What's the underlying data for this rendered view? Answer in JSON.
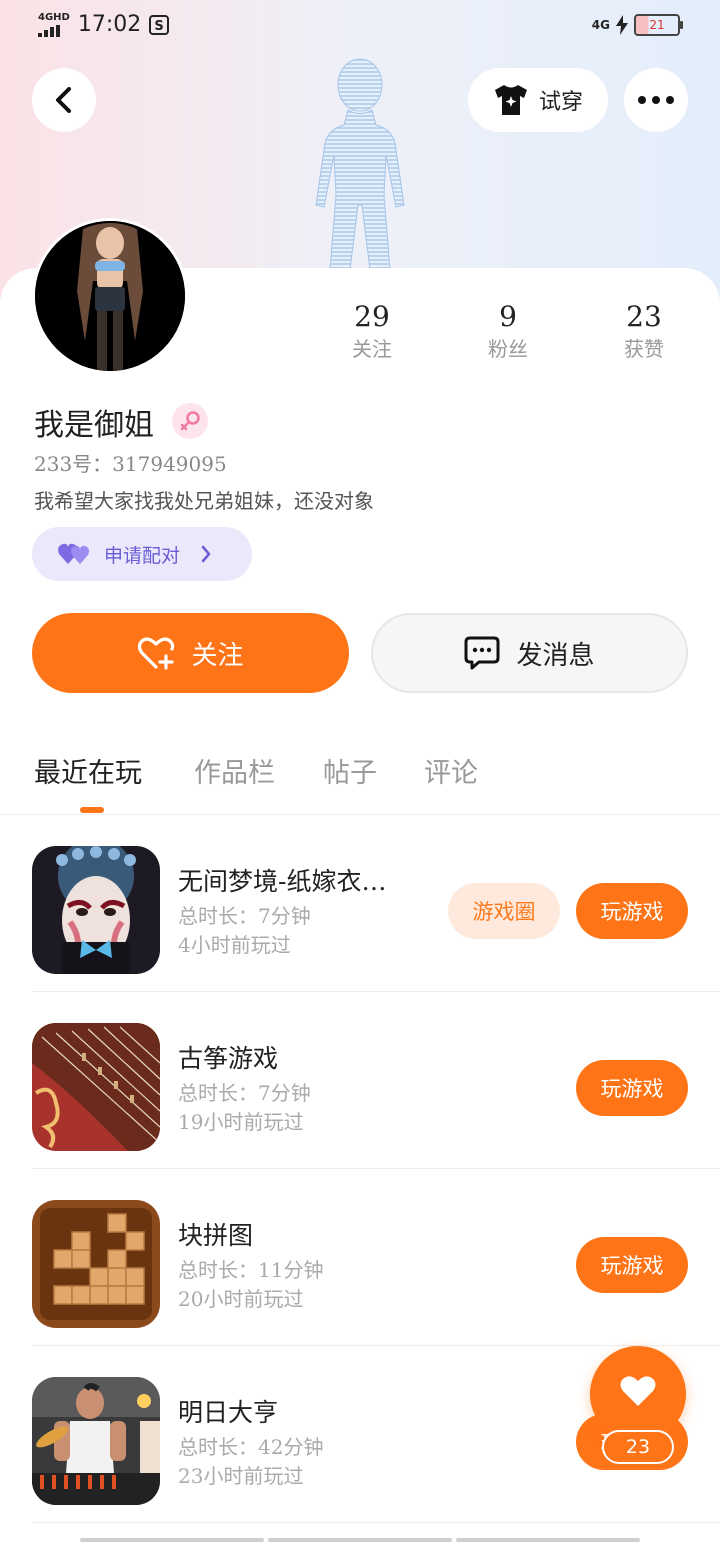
{
  "status_bar": {
    "network_left": "4GHD",
    "time": "17:02",
    "network_right": "4G",
    "battery": "21"
  },
  "header": {
    "try_on_label": "试穿"
  },
  "profile": {
    "nickname": "我是御姐",
    "uid": "233号：317949095",
    "bio": "我希望大家找我处兄弟姐妹，还没对象",
    "match_label": "申请配对",
    "stats": [
      {
        "value": "29",
        "label": "关注"
      },
      {
        "value": "9",
        "label": "粉丝"
      },
      {
        "value": "23",
        "label": "获赞"
      }
    ]
  },
  "actions": {
    "follow_label": "关注",
    "message_label": "发消息"
  },
  "tabs": [
    "最近在玩",
    "作品栏",
    "帖子",
    "评论"
  ],
  "games": [
    {
      "title": "无间梦境-纸嫁衣…",
      "duration": "总时长：7分钟",
      "last_played": "4小时前玩过",
      "circle": "游戏圈",
      "play": "玩游戏"
    },
    {
      "title": "古筝游戏",
      "duration": "总时长：7分钟",
      "last_played": "19小时前玩过",
      "play": "玩游戏"
    },
    {
      "title": "块拼图",
      "duration": "总时长：11分钟",
      "last_played": "20小时前玩过",
      "play": "玩游戏"
    },
    {
      "title": "明日大亨",
      "duration": "总时长：42分钟",
      "last_played": "23小时前玩过",
      "play": "玩游戏"
    }
  ],
  "like_fab": {
    "count": "23"
  },
  "colors": {
    "accent": "#ff7416",
    "match_purple": "#6a5dd6"
  }
}
